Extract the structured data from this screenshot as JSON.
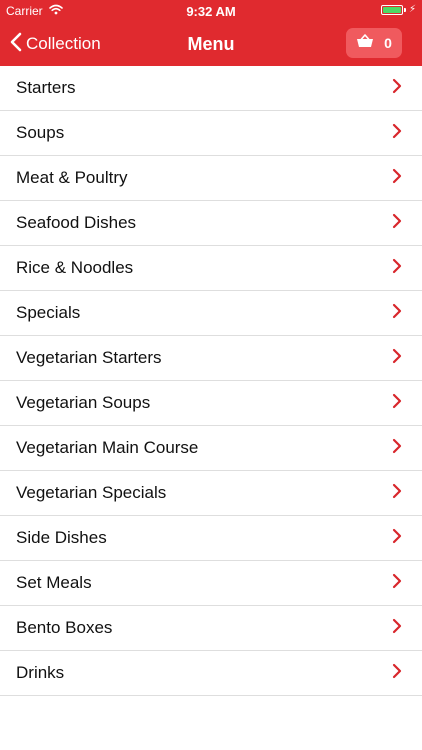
{
  "colors": {
    "brand": "#e02a2f",
    "basket_bg": "#f05a5e",
    "battery": "#4cd964",
    "chevron": "#d8262c",
    "text": "#111111",
    "divider": "#dedede"
  },
  "status_bar": {
    "carrier": "Carrier",
    "time": "9:32 AM",
    "wifi_icon": "wifi-icon",
    "battery_icon": "battery-icon",
    "battery_level": 1.0,
    "charging_icon": "bolt-icon"
  },
  "nav": {
    "back_label": "Collection",
    "back_icon": "chevron-left-icon",
    "title": "Menu",
    "basket_icon": "basket-icon",
    "basket_count": "0"
  },
  "menu": {
    "row_icon": "chevron-right-icon",
    "items": [
      {
        "label": "Starters"
      },
      {
        "label": "Soups"
      },
      {
        "label": "Meat & Poultry"
      },
      {
        "label": "Seafood Dishes"
      },
      {
        "label": "Rice & Noodles"
      },
      {
        "label": "Specials"
      },
      {
        "label": "Vegetarian Starters"
      },
      {
        "label": "Vegetarian Soups"
      },
      {
        "label": "Vegetarian Main Course"
      },
      {
        "label": "Vegetarian Specials"
      },
      {
        "label": "Side Dishes"
      },
      {
        "label": "Set Meals"
      },
      {
        "label": "Bento Boxes"
      },
      {
        "label": "Drinks"
      }
    ]
  }
}
